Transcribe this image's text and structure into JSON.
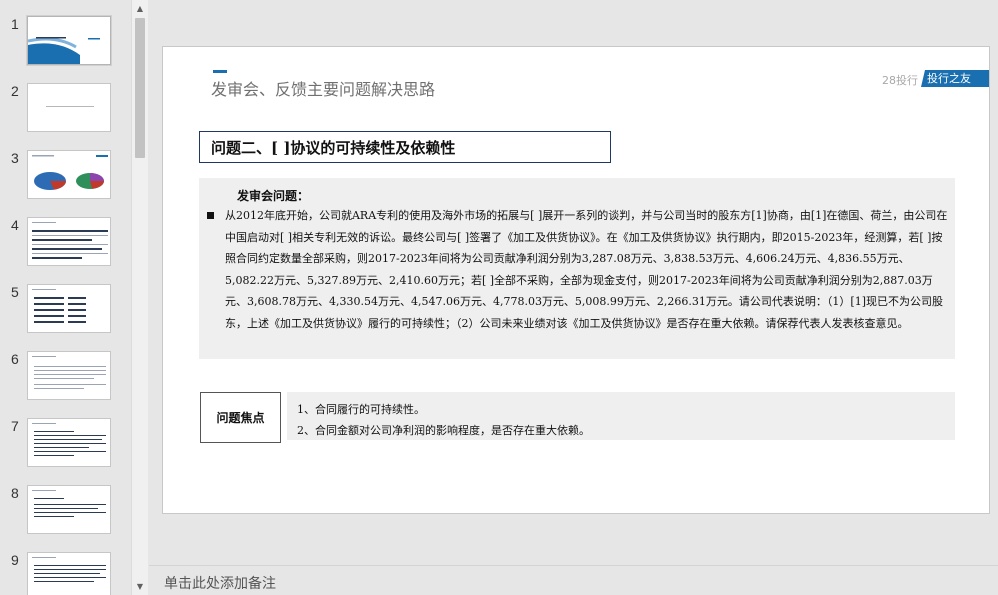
{
  "thumbnails": [
    {
      "number": "1"
    },
    {
      "number": "2"
    },
    {
      "number": "3"
    },
    {
      "number": "4"
    },
    {
      "number": "5"
    },
    {
      "number": "6"
    },
    {
      "number": "7"
    },
    {
      "number": "8"
    },
    {
      "number": "9"
    }
  ],
  "selected_slide": "1",
  "scrollbar": {
    "up_icon": "chevron-up-icon",
    "down_icon": "chevron-down-icon"
  },
  "slide": {
    "title": "发审会、反馈主要问题解决思路",
    "brand_prefix": "28投行",
    "brand_tag": "投行之友",
    "question_heading": "问题二、[ ]协议的可持续性及依赖性",
    "review_label": "发审会问题：",
    "review_text": "从2012年底开始，公司就ARA专利的使用及海外市场的拓展与[ ]展开一系列的谈判，并与公司当时的股东方[1]协商，由[1]在德国、荷兰，由公司在中国启动对[ ]相关专利无效的诉讼。最终公司与[ ]签署了《加工及供货协议》。在《加工及供货协议》执行期内，即2015-2023年，经测算，若[ ]按照合同约定数量全部采购，则2017-2023年间将为公司贡献净利润分别为3,287.08万元、3,838.53万元、4,606.24万元、4,836.55万元、5,082.22万元、5,327.89万元、2,410.60万元；若[ ]全部不采购，全部为现金支付，则2017-2023年间将为公司贡献净利润分别为2,887.03万元、3,608.78万元、4,330.54万元、4,547.06万元、4,778.03万元、5,008.99万元、2,266.31万元。请公司代表说明：（1）[1]现已不为公司股东，上述《加工及供货协议》履行的可持续性；（2）公司未来业绩对该《加工及供货协议》是否存在重大依赖。请保荐代表人发表核查意见。",
    "focus_label": "问题焦点",
    "focus_items": [
      "1、合同履行的可持续性。",
      "2、合同金额对公司净利润的影响程度，是否存在重大依赖。"
    ]
  },
  "notes": {
    "placeholder": "单击此处添加备注"
  },
  "colors": {
    "accent": "#1a6fb0",
    "panel": "#efefef",
    "border": "#1f3864"
  }
}
